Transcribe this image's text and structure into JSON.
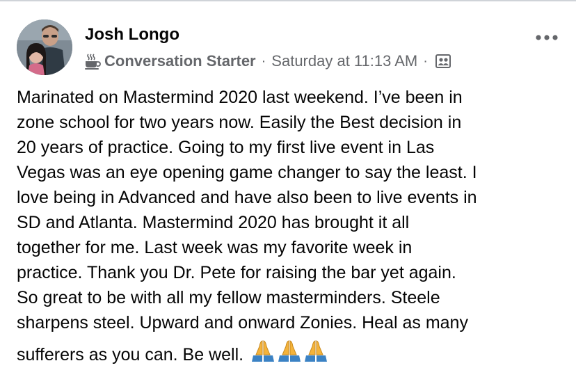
{
  "post": {
    "author": "Josh Longo",
    "badge_label": "Conversation Starter",
    "separator": "·",
    "timestamp": "Saturday at 11:13 AM",
    "more_label": "•••",
    "body_lines": [
      "Marinated on Mastermind 2020 last weekend.  I’ve been in",
      "zone school for two years now. Easily the Best decision in",
      "20 years of practice.  Going to my first live event in Las",
      "Vegas was an eye opening game changer to say the least.  I",
      "love being in Advanced and have also been to live events in",
      "SD and Atlanta.  Mastermind 2020 has brought it all",
      "together for me.  Last week was my favorite week in",
      "practice.  Thank you Dr. Pete for raising the bar yet again.",
      "So great to be with all my fellow masterminders. Steele",
      "sharpens steel.  Upward and onward Zonies. Heal as many",
      "sufferers as you can.  Be well."
    ],
    "icons": {
      "badge": "coffee-cup-icon",
      "audience": "group-audience-icon",
      "more": "more-options-icon",
      "emoji": "folded-hands-emoji"
    },
    "emoji_count": 3
  },
  "colors": {
    "text_primary": "#050505",
    "text_secondary": "#65676b",
    "border": "#cfd3d8",
    "emoji_sleeve": "#3b82c4",
    "emoji_hand": "#f4b33b"
  }
}
